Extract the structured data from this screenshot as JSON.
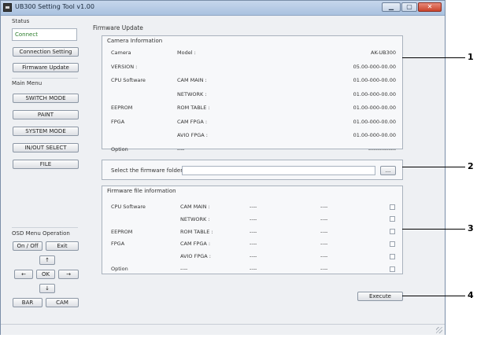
{
  "window": {
    "title": "UB300 Setting Tool v1.00"
  },
  "left": {
    "status_label": "Status",
    "status_value": "Connect",
    "connection_setting": "Connection Setting",
    "firmware_update": "Firmware Update",
    "main_menu_label": "Main Menu",
    "menu": [
      "SWITCH MODE",
      "PAINT",
      "SYSTEM MODE",
      "IN/OUT SELECT",
      "FILE"
    ],
    "osd_label": "OSD Menu Operation",
    "osd": {
      "on_off": "On / Off",
      "exit": "Exit",
      "up": "↑",
      "left": "←",
      "ok": "OK",
      "right": "→",
      "down": "↓",
      "bar": "BAR",
      "cam": "CAM"
    }
  },
  "main": {
    "title": "Firmware Update",
    "camera_info": {
      "label": "Camera  Information",
      "rows": [
        {
          "c1": "Camera",
          "c2": "Model :",
          "val": "AK-UB300"
        },
        {
          "c1": "VERSION :",
          "c2": "",
          "val": "05.00-000-00.00"
        },
        {
          "c1": "CPU Software",
          "c2": "CAM MAIN :",
          "val": "01.00-000-00.00"
        },
        {
          "c1": "",
          "c2": "NETWORK :",
          "val": "01.00-000-00.00"
        },
        {
          "c1": "EEPROM",
          "c2": "ROM TABLE :",
          "val": "01.00-000-00.00"
        },
        {
          "c1": "FPGA",
          "c2": "CAM FPGA :",
          "val": "01.00-000-00.00"
        },
        {
          "c1": "",
          "c2": "AVIO FPGA :",
          "val": "01.00-000-00.00"
        },
        {
          "c1": "Option",
          "c2": "----",
          "val": "---------------"
        }
      ]
    },
    "folder": {
      "label": "Select the firmware folder",
      "value": "",
      "browse": "..."
    },
    "file_info": {
      "label": "Firmware file information",
      "rows": [
        {
          "c1": "CPU Software",
          "c2": "CAM MAIN :",
          "v1": "----",
          "v2": "----"
        },
        {
          "c1": "",
          "c2": "NETWORK :",
          "v1": "----",
          "v2": "----"
        },
        {
          "c1": "EEPROM",
          "c2": "ROM TABLE :",
          "v1": "----",
          "v2": "----"
        },
        {
          "c1": "FPGA",
          "c2": "CAM FPGA :",
          "v1": "----",
          "v2": "----"
        },
        {
          "c1": "",
          "c2": "AVIO FPGA :",
          "v1": "----",
          "v2": "----"
        },
        {
          "c1": "Option",
          "c2": "----",
          "v1": "----",
          "v2": "----"
        }
      ]
    },
    "execute": "Execute"
  },
  "callouts": [
    "1",
    "2",
    "3",
    "4"
  ]
}
